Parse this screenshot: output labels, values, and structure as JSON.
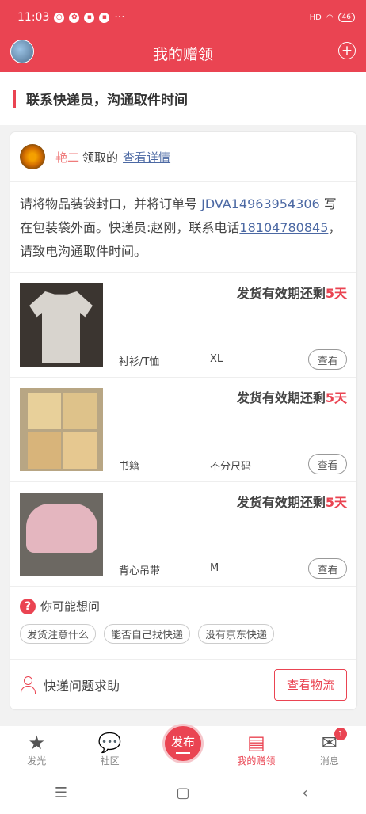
{
  "status": {
    "time": "11:03",
    "dots": "···",
    "network": "HD",
    "battery": "46"
  },
  "header": {
    "title": "我的赠领",
    "plus": "+"
  },
  "section": {
    "title": "联系快递员，沟通取件时间"
  },
  "claim": {
    "name": "艳二",
    "verb": "领取的",
    "detail_link": "查看详情"
  },
  "instruction": {
    "part1": "请将物品装袋封口，并将订单号 ",
    "order_no": "JDVA14963954306",
    "part2": " 写在包装袋外面。快递员:赵刚，联系电话",
    "phone": "18104780845",
    "part3": "，请致电沟通取件时间。"
  },
  "expire_prefix": "发货有效期还剩",
  "items": [
    {
      "name": "衬衫/T恤",
      "size": "XL",
      "days": "5天",
      "button": "查看"
    },
    {
      "name": "书籍",
      "size": "不分尺码",
      "days": "5天",
      "button": "查看"
    },
    {
      "name": "背心吊带",
      "size": "M",
      "days": "5天",
      "button": "查看"
    }
  ],
  "faq": {
    "title": "你可能想问",
    "icon": "?",
    "tags": [
      "发货注意什么",
      "能否自己找快递",
      "没有京东快递"
    ]
  },
  "help": {
    "label": "快递问题求助",
    "button": "查看物流"
  },
  "tabs": [
    {
      "label": "发光",
      "icon": "★"
    },
    {
      "label": "社区",
      "icon": "💬"
    },
    {
      "label": "发布"
    },
    {
      "label": "我的赠领",
      "icon": "▤"
    },
    {
      "label": "消息",
      "icon": "✉",
      "badge": "1"
    }
  ],
  "sysnav": {
    "menu": "☰",
    "home": "▢",
    "back": "‹"
  },
  "colors": {
    "primary": "#ea4452",
    "link": "#4b68a3"
  }
}
